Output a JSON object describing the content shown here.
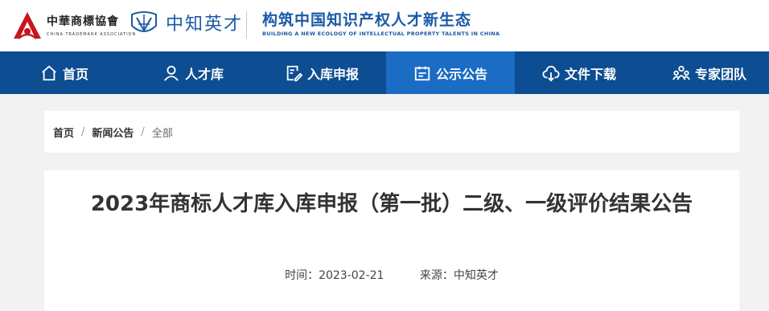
{
  "header": {
    "association_name": "中華商標協會",
    "association_en": "CHINA TRADEMARK ASSOCIATION",
    "brand_name": "中知英才",
    "slogan": "构筑中国知识产权人才新生态",
    "slogan_en": "BUILDING A NEW ECOLOGY OF INTELLECTUAL PROPERTY TALENTS IN CHINA"
  },
  "nav": {
    "items": [
      {
        "label": "首页",
        "icon": "home-icon"
      },
      {
        "label": "人才库",
        "icon": "person-icon"
      },
      {
        "label": "入库申报",
        "icon": "edit-document-icon"
      },
      {
        "label": "公示公告",
        "icon": "announcement-icon",
        "active": true
      },
      {
        "label": "文件下载",
        "icon": "cloud-download-icon"
      },
      {
        "label": "专家团队",
        "icon": "team-icon"
      }
    ]
  },
  "breadcrumb": {
    "home": "首页",
    "section": "新闻公告",
    "current": "全部",
    "separator": "/"
  },
  "article": {
    "title": "2023年商标人才库入库申报（第一批）二级、一级评价结果公告",
    "time_label": "时间：2023-02-21",
    "source_label": "来源：中知英才"
  },
  "colors": {
    "nav_bg": "#0d4d91",
    "nav_active": "#1a6cc5",
    "brand_blue": "#1a5aa6",
    "logo_red": "#c8161d"
  }
}
